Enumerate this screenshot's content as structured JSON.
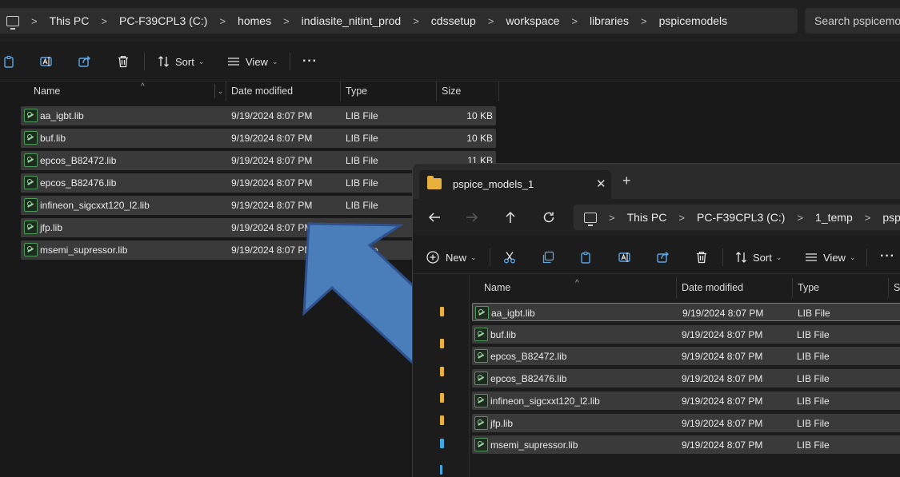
{
  "back_window": {
    "breadcrumb": [
      "This PC",
      "PC-F39CPL3 (C:)",
      "homes",
      "indiasite_nitint_prod",
      "cdssetup",
      "workspace",
      "libraries",
      "pspicemodels"
    ],
    "search_placeholder": "Search pspicemo",
    "toolbar": {
      "sort_label": "Sort",
      "view_label": "View"
    },
    "columns": {
      "name": "Name",
      "date": "Date modified",
      "type": "Type",
      "size": "Size"
    },
    "files": [
      {
        "name": "aa_igbt.lib",
        "date": "9/19/2024 8:07 PM",
        "type": "LIB File",
        "size": "10 KB"
      },
      {
        "name": "buf.lib",
        "date": "9/19/2024 8:07 PM",
        "type": "LIB File",
        "size": "10 KB"
      },
      {
        "name": "epcos_B82472.lib",
        "date": "9/19/2024 8:07 PM",
        "type": "LIB File",
        "size": "11 KB"
      },
      {
        "name": "epcos_B82476.lib",
        "date": "9/19/2024 8:07 PM",
        "type": "LIB File",
        "size": ""
      },
      {
        "name": "infineon_sigcxxt120_l2.lib",
        "date": "9/19/2024 8:07 PM",
        "type": "LIB File",
        "size": ""
      },
      {
        "name": "jfp.lib",
        "date": "9/19/2024 8:07 PM",
        "type": "LIB File",
        "size": ""
      },
      {
        "name": "msemi_supressor.lib",
        "date": "9/19/2024 8:07 PM",
        "type": "LIB File",
        "size": ""
      }
    ]
  },
  "front_window": {
    "tab_title": "pspice_models_1",
    "breadcrumb": [
      "This PC",
      "PC-F39CPL3 (C:)",
      "1_temp",
      "pspic"
    ],
    "toolbar": {
      "new_label": "New",
      "sort_label": "Sort",
      "view_label": "View"
    },
    "columns": {
      "name": "Name",
      "date": "Date modified",
      "type": "Type",
      "size": "Si"
    },
    "files": [
      {
        "name": "aa_igbt.lib",
        "date": "9/19/2024 8:07 PM",
        "type": "LIB File"
      },
      {
        "name": "buf.lib",
        "date": "9/19/2024 8:07 PM",
        "type": "LIB File"
      },
      {
        "name": "epcos_B82472.lib",
        "date": "9/19/2024 8:07 PM",
        "type": "LIB File"
      },
      {
        "name": "epcos_B82476.lib",
        "date": "9/19/2024 8:07 PM",
        "type": "LIB File"
      },
      {
        "name": "infineon_sigcxxt120_l2.lib",
        "date": "9/19/2024 8:07 PM",
        "type": "LIB File"
      },
      {
        "name": "jfp.lib",
        "date": "9/19/2024 8:07 PM",
        "type": "LIB File"
      },
      {
        "name": "msemi_supressor.lib",
        "date": "9/19/2024 8:07 PM",
        "type": "LIB File"
      }
    ]
  },
  "colors": {
    "arrow_fill": "#4a7ebb",
    "arrow_stroke": "#2f528f",
    "selection": "#3a3a3a",
    "folder": "#e7b13c",
    "lib_icon": "#4f9a5b"
  },
  "icons": [
    "pc-icon",
    "clipboard-icon",
    "rename-icon",
    "share-icon",
    "delete-icon",
    "sort-icon",
    "view-icon",
    "more-icon",
    "folder-icon",
    "close-icon",
    "add-tab-icon",
    "back-arrow-icon",
    "forward-arrow-icon",
    "up-arrow-icon",
    "refresh-icon",
    "new-icon",
    "cut-icon",
    "copy-icon",
    "paste-icon",
    "lib-file-icon"
  ]
}
